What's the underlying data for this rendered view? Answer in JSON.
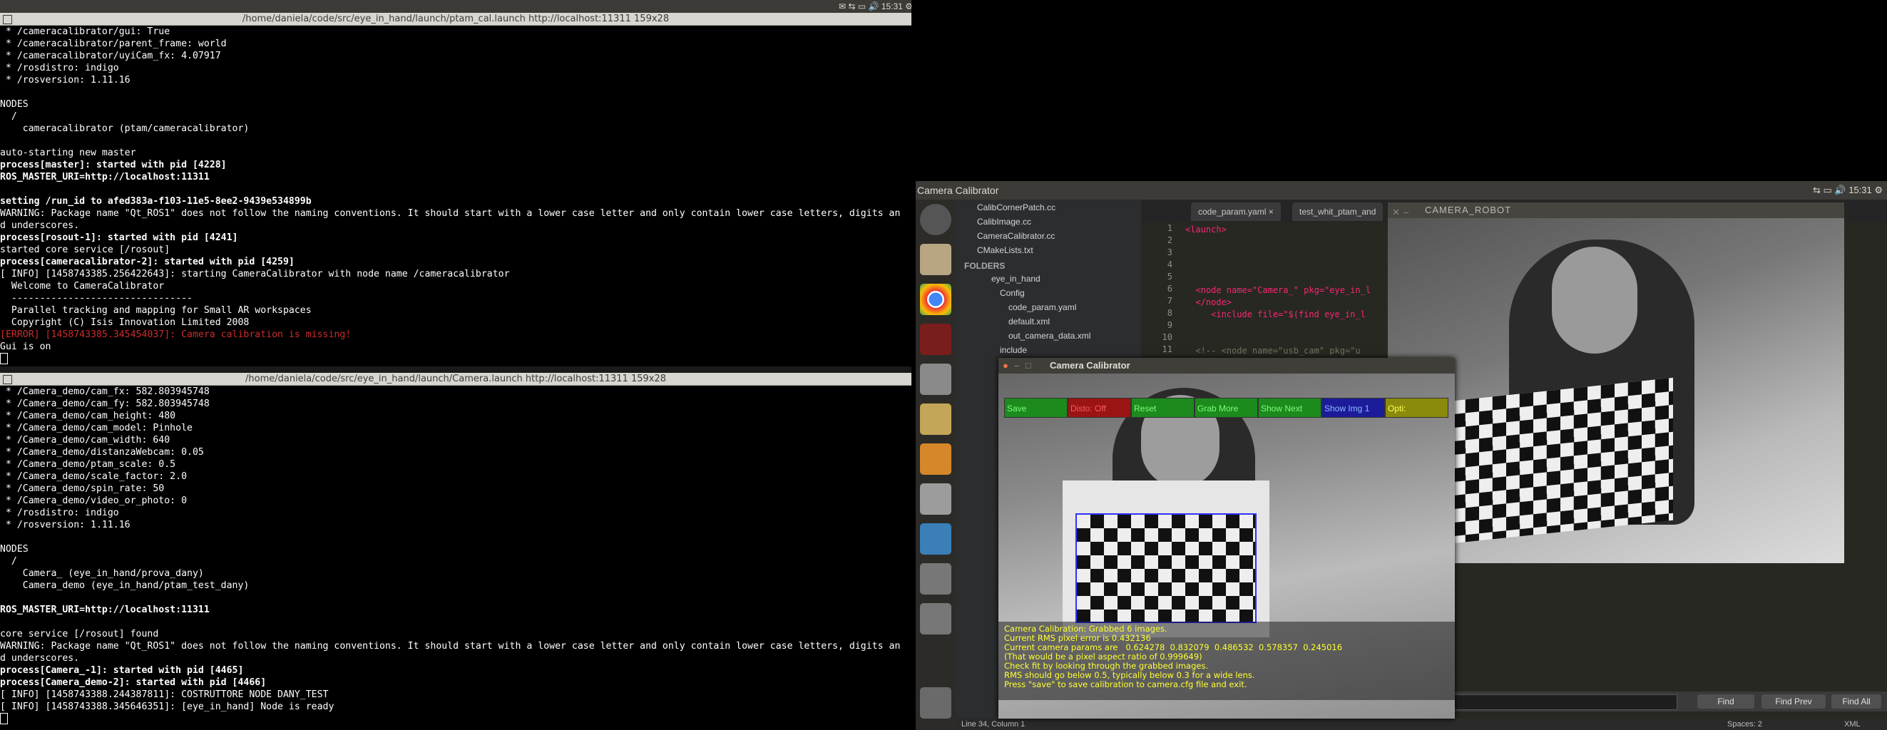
{
  "topbar": {
    "indicators": "✉ ⇆ ▭ 🔊 15:31 ⚙"
  },
  "terminal1": {
    "title": "/home/daniela/code/src/eye_in_hand/launch/ptam_cal.launch http://localhost:11311 159x28",
    "lines": [
      " * /cameracalibrator/gui: True",
      " * /cameracalibrator/parent_frame: world",
      " * /cameracalibrator/uyiCam_fx: 4.07917",
      " * /rosdistro: indigo",
      " * /rosversion: 1.11.16",
      "",
      "NODES",
      "  /",
      "    cameracalibrator (ptam/cameracalibrator)",
      "",
      "auto-starting new master",
      "process[master]: started with pid [4228]",
      "ROS_MASTER_URI=http://localhost:11311",
      "",
      "setting /run_id to afed383a-f103-11e5-8ee2-9439e534899b",
      "WARNING: Package name \"Qt_ROS1\" does not follow the naming conventions. It should start with a lower case letter and only contain lower case letters, digits an",
      "d underscores.",
      "process[rosout-1]: started with pid [4241]",
      "started core service [/rosout]",
      "process[cameracalibrator-2]: started with pid [4259]",
      "[ INFO] [1458743385.256422643]: starting CameraCalibrator with node name /cameracalibrator",
      "  Welcome to CameraCalibrator",
      "  --------------------------------",
      "  Parallel tracking and mapping for Small AR workspaces",
      "  Copyright (C) Isis Innovation Limited 2008",
      "[ERROR] [1458743385.345454037]: Camera calibration is missing!",
      "Gui is on"
    ]
  },
  "terminal2": {
    "title": "/home/daniela/code/src/eye_in_hand/launch/Camera.launch http://localhost:11311 159x28",
    "lines": [
      " * /Camera_demo/cam_fx: 582.803945748",
      " * /Camera_demo/cam_fy: 582.803945748",
      " * /Camera_demo/cam_height: 480",
      " * /Camera_demo/cam_model: Pinhole",
      " * /Camera_demo/cam_width: 640",
      " * /Camera_demo/distanzaWebcam: 0.05",
      " * /Camera_demo/ptam_scale: 0.5",
      " * /Camera_demo/scale_factor: 2.0",
      " * /Camera_demo/spin_rate: 50",
      " * /Camera_demo/video_or_photo: 0",
      " * /rosdistro: indigo",
      " * /rosversion: 1.11.16",
      "",
      "NODES",
      "  /",
      "    Camera_ (eye_in_hand/prova_dany)",
      "    Camera_demo (eye_in_hand/ptam_test_dany)",
      "",
      "ROS_MASTER_URI=http://localhost:11311",
      "",
      "core service [/rosout] found",
      "WARNING: Package name \"Qt_ROS1\" does not follow the naming conventions. It should start with a lower case letter and only contain lower case letters, digits an",
      "d underscores.",
      "process[Camera_-1]: started with pid [4465]",
      "process[Camera_demo-2]: started with pid [4466]",
      "[ INFO] [1458743388.244387811]: COSTRUTTORE NODE DANY_TEST",
      "[ INFO] [1458743388.345646351]: [eye_in_hand] Node is ready"
    ]
  },
  "panel": {
    "title": "Camera Calibrator",
    "indicators": "⇆ ▭ 🔊 15:31 ⚙"
  },
  "sidebar": {
    "files": [
      "CalibCornerPatch.cc",
      "CalibImage.cc",
      "CameraCalibrator.cc",
      "CMakeLists.txt"
    ],
    "folders_label": "FOLDERS",
    "tree": [
      "eye_in_hand",
      "Config",
      "code_param.yaml",
      "default.xml",
      "out_camera_data.xml",
      "include"
    ]
  },
  "editor": {
    "tabs": [
      "code_param.yaml",
      "test_whit_ptam_and"
    ],
    "line_numbers": [
      "1",
      "2",
      "3",
      "4",
      "5",
      "6",
      "7",
      "8",
      "9",
      "10",
      "11"
    ],
    "code": [
      "<launch>",
      "",
      "",
      "",
      "",
      "  <node name=\"Camera_\" pkg=\"eye_in_l",
      "  </node>",
      "     <include file=\"$(find eye_in_l",
      "",
      "",
      "  <!-- <node name=\"usb_cam\" pkg=\"u"
    ],
    "find_buttons": [
      "Find",
      "Find Prev",
      "Find All"
    ],
    "status_left": "Line 34, Column 1",
    "status_spaces": "Spaces: 2",
    "status_syntax": "XML"
  },
  "camera_robot": {
    "title": "CAMERA_ROBOT"
  },
  "calibrator": {
    "title": "Camera Calibrator",
    "buttons": [
      {
        "label": "Save",
        "bg": "#1c8a1c",
        "fg": "#7cff7c"
      },
      {
        "label": "Disto: Off",
        "bg": "#9a1414",
        "fg": "#ff5a5a"
      },
      {
        "label": "Reset",
        "bg": "#1c8a1c",
        "fg": "#7cff7c"
      },
      {
        "label": "Grab More",
        "bg": "#1c8a1c",
        "fg": "#7cff7c"
      },
      {
        "label": "Show Next",
        "bg": "#1c8a1c",
        "fg": "#7cff7c"
      },
      {
        "label": "Show Img 1",
        "bg": "#1c1c9a",
        "fg": "#8fb8ff"
      },
      {
        "label": "Opti:",
        "bg": "#8a8a0c",
        "fg": "#ffff55"
      }
    ],
    "overlay": [
      "Camera Calibration: Grabbed 6 images.",
      "Current RMS pixel error is 0.432136",
      "Current camera params are   0.624278  0.832079  0.486532  0.578357  0.245016",
      "(That would be a pixel aspect ratio of 0.999649)",
      "Check fit by looking through the grabbed images.",
      "RMS should go below 0.5, typically below 0.3 for a wide lens.",
      "Press \"save\" to save calibration to camera.cfg file and exit."
    ]
  }
}
